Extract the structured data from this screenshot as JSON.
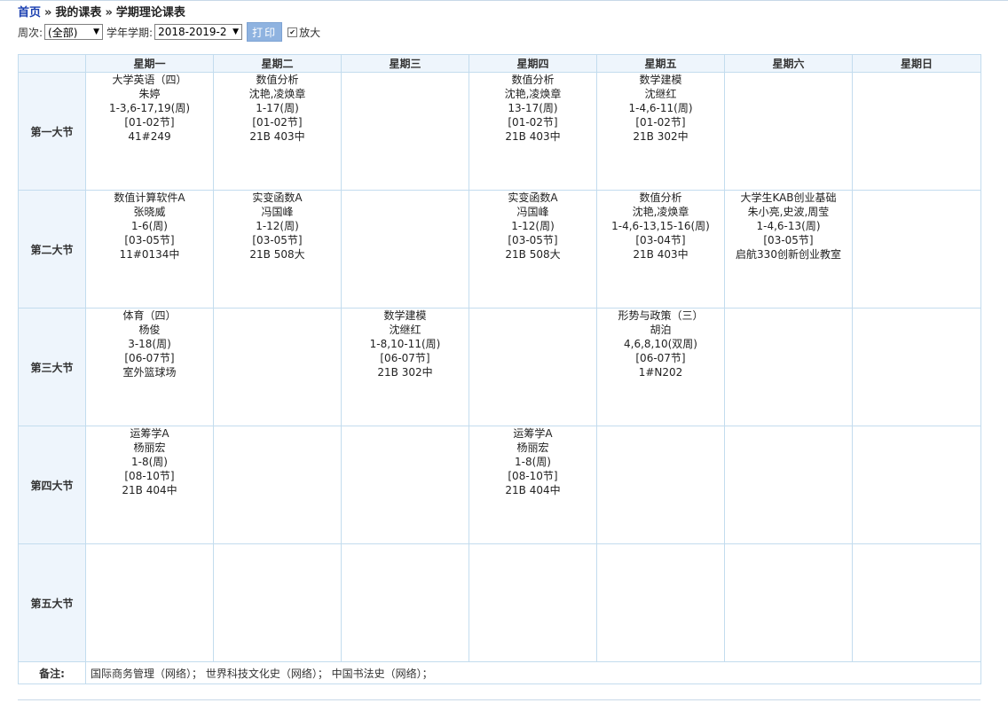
{
  "breadcrumb": {
    "home": "首页",
    "sep": "»",
    "my_schedule": "我的课表",
    "current": "学期理论课表"
  },
  "toolbar": {
    "week_label": "周次:",
    "week_value": "(全部)",
    "term_label": "学年学期:",
    "term_value": "2018-2019-2",
    "print_label": "打印",
    "zoom_label": "放大",
    "zoom_checked": true
  },
  "days": [
    "星期一",
    "星期二",
    "星期三",
    "星期四",
    "星期五",
    "星期六",
    "星期日"
  ],
  "slots": [
    {
      "label": "第一大节",
      "cells": [
        [
          "大学英语（四）",
          "朱婷",
          "1-3,6-17,19(周)",
          "[01-02节]",
          "41#249"
        ],
        [
          "数值分析",
          "沈艳,凌焕章",
          "1-17(周)",
          "[01-02节]",
          "21B 403中"
        ],
        [],
        [
          "数值分析",
          "沈艳,凌焕章",
          "13-17(周)",
          "[01-02节]",
          "21B 403中"
        ],
        [
          "数学建模",
          "沈继红",
          "1-4,6-11(周)",
          "[01-02节]",
          "21B 302中"
        ],
        [],
        []
      ]
    },
    {
      "label": "第二大节",
      "cells": [
        [
          "数值计算软件A",
          "张晓威",
          "1-6(周)",
          "[03-05节]",
          "11#0134中"
        ],
        [
          "实变函数A",
          "冯国峰",
          "1-12(周)",
          "[03-05节]",
          "21B 508大"
        ],
        [],
        [
          "实变函数A",
          "冯国峰",
          "1-12(周)",
          "[03-05节]",
          "21B 508大"
        ],
        [
          "数值分析",
          "沈艳,凌焕章",
          "1-4,6-13,15-16(周)",
          "[03-04节]",
          "21B 403中"
        ],
        [
          "大学生KAB创业基础",
          "朱小亮,史波,周莹",
          "1-4,6-13(周)",
          "[03-05节]",
          "启航330创新创业教室"
        ],
        []
      ]
    },
    {
      "label": "第三大节",
      "cells": [
        [
          "体育（四）",
          "杨俊",
          "3-18(周)",
          "[06-07节]",
          "室外篮球场"
        ],
        [],
        [
          "数学建模",
          "沈继红",
          "1-8,10-11(周)",
          "[06-07节]",
          "21B 302中"
        ],
        [],
        [
          "形势与政策（三）",
          "胡泊",
          "4,6,8,10(双周)",
          "[06-07节]",
          "1#N202"
        ],
        [],
        []
      ]
    },
    {
      "label": "第四大节",
      "cells": [
        [
          "运筹学A",
          "杨丽宏",
          "1-8(周)",
          "[08-10节]",
          "21B 404中"
        ],
        [],
        [],
        [
          "运筹学A",
          "杨丽宏",
          "1-8(周)",
          "[08-10节]",
          "21B 404中"
        ],
        [],
        [],
        []
      ]
    },
    {
      "label": "第五大节",
      "cells": [
        [],
        [],
        [],
        [],
        [],
        [],
        []
      ]
    }
  ],
  "remark": {
    "label": "备注:",
    "text": "国际商务管理（网络）；  世界科技文化史（网络）；  中国书法史（网络）；"
  },
  "colors": {
    "link": "#1a3fb0",
    "header_bg": "#eef5fc",
    "grid_border": "#c3dcee",
    "print_button": "#8fb3e0"
  }
}
